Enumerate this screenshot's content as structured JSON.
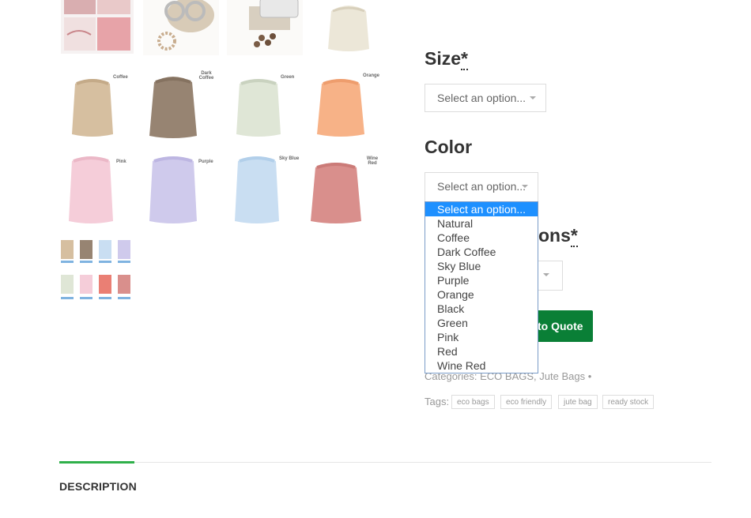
{
  "gallery": {
    "thumbs": [
      {
        "name": "thumb-multicolor",
        "label": ""
      },
      {
        "name": "thumb-sunglasses-beads",
        "label": ""
      },
      {
        "name": "thumb-phone-coffee",
        "label": ""
      },
      {
        "name": "thumb-natural",
        "label": ""
      },
      {
        "name": "thumb-coffee",
        "label": "Coffee"
      },
      {
        "name": "thumb-dark-coffee",
        "label": "Dark Coffee"
      },
      {
        "name": "thumb-green",
        "label": "Green"
      },
      {
        "name": "thumb-orange",
        "label": "Orange"
      },
      {
        "name": "thumb-pink",
        "label": "Pink"
      },
      {
        "name": "thumb-purple",
        "label": "Purple"
      },
      {
        "name": "thumb-sky-blue",
        "label": "Sky Blue"
      },
      {
        "name": "thumb-wine-red",
        "label": "Wine Red"
      },
      {
        "name": "thumb-color-chart",
        "label": ""
      }
    ]
  },
  "form": {
    "size_label": "Size",
    "required_mark": "*",
    "size_select_value": "Select an option...",
    "color_label": "Color",
    "color_select_value": "Select an option...",
    "options_label_partial": "ons",
    "color_options": [
      "Select an option...",
      "Natural",
      "Coffee",
      "Dark Coffee",
      "Sky Blue",
      "Purple",
      "Orange",
      "Black",
      "Green",
      "Pink",
      "Red",
      "Wine Red"
    ],
    "quote_button": "to Quote"
  },
  "meta": {
    "categories_label": "Categories:",
    "categories": [
      "ECO BAGS",
      "Jute Bags"
    ],
    "tags_label": "Tags:",
    "tags": [
      "eco bags",
      "eco friendly",
      "jute bag",
      "ready stock"
    ]
  },
  "tabs": {
    "description": "DESCRIPTION"
  },
  "colors": {
    "accent_green": "#0a7f36",
    "tab_active": "#2fb04a",
    "selected_option": "#1e90ff"
  }
}
